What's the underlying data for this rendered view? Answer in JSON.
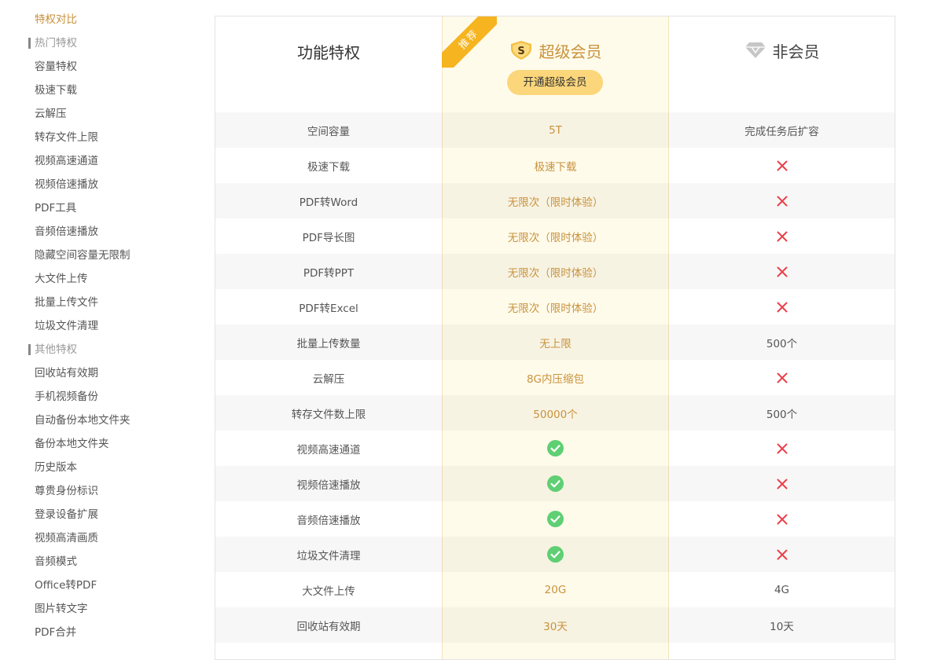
{
  "sidebar": [
    {
      "type": "item",
      "label": "特权对比",
      "active": true
    },
    {
      "type": "group",
      "label": "热门特权"
    },
    {
      "type": "item",
      "label": "容量特权"
    },
    {
      "type": "item",
      "label": "极速下载"
    },
    {
      "type": "item",
      "label": "云解压"
    },
    {
      "type": "item",
      "label": "转存文件上限"
    },
    {
      "type": "item",
      "label": "视频高速通道"
    },
    {
      "type": "item",
      "label": "视频倍速播放"
    },
    {
      "type": "item",
      "label": "PDF工具"
    },
    {
      "type": "item",
      "label": "音频倍速播放"
    },
    {
      "type": "item",
      "label": "隐藏空间容量无限制"
    },
    {
      "type": "item",
      "label": "大文件上传"
    },
    {
      "type": "item",
      "label": "批量上传文件"
    },
    {
      "type": "item",
      "label": "垃圾文件清理"
    },
    {
      "type": "group",
      "label": "其他特权"
    },
    {
      "type": "item",
      "label": "回收站有效期"
    },
    {
      "type": "item",
      "label": "手机视频备份"
    },
    {
      "type": "item",
      "label": "自动备份本地文件夹"
    },
    {
      "type": "item",
      "label": "备份本地文件夹"
    },
    {
      "type": "item",
      "label": "历史版本"
    },
    {
      "type": "item",
      "label": "尊贵身份标识"
    },
    {
      "type": "item",
      "label": "登录设备扩展"
    },
    {
      "type": "item",
      "label": "视频高清画质"
    },
    {
      "type": "item",
      "label": "音频模式"
    },
    {
      "type": "item",
      "label": "Office转PDF"
    },
    {
      "type": "item",
      "label": "图片转文字"
    },
    {
      "type": "item",
      "label": "PDF合并"
    }
  ],
  "header": {
    "feature_label": "功能特权",
    "super_title": "超级会员",
    "super_icon": "s-badge-icon",
    "normal_title": "非会员",
    "normal_icon": "diamond-icon",
    "recommend_ribbon": "推荐",
    "upgrade_button": "开通超级会员"
  },
  "colors": {
    "gold": "#c8923d",
    "button_bg": "#fbd67a",
    "ribbon": "#f5b420",
    "super_bg": "#fffbeb",
    "check": "#5fcf73",
    "cross": "#e9414b"
  },
  "rows": [
    {
      "feature": "空间容量",
      "super": {
        "text": "5T"
      },
      "normal": {
        "text": "完成任务后扩容"
      }
    },
    {
      "feature": "极速下载",
      "super": {
        "text": "极速下载"
      },
      "normal": {
        "icon": "cross-icon"
      }
    },
    {
      "feature": "PDF转Word",
      "super": {
        "text": "无限次（限时体验）"
      },
      "normal": {
        "icon": "cross-icon"
      }
    },
    {
      "feature": "PDF导长图",
      "super": {
        "text": "无限次（限时体验）"
      },
      "normal": {
        "icon": "cross-icon"
      }
    },
    {
      "feature": "PDF转PPT",
      "super": {
        "text": "无限次（限时体验）"
      },
      "normal": {
        "icon": "cross-icon"
      }
    },
    {
      "feature": "PDF转Excel",
      "super": {
        "text": "无限次（限时体验）"
      },
      "normal": {
        "icon": "cross-icon"
      }
    },
    {
      "feature": "批量上传数量",
      "super": {
        "text": "无上限"
      },
      "normal": {
        "text": "500个"
      }
    },
    {
      "feature": "云解压",
      "super": {
        "text": "8G内压缩包"
      },
      "normal": {
        "icon": "cross-icon"
      }
    },
    {
      "feature": "转存文件数上限",
      "super": {
        "text": "50000个"
      },
      "normal": {
        "text": "500个"
      }
    },
    {
      "feature": "视频高速通道",
      "super": {
        "icon": "check-icon"
      },
      "normal": {
        "icon": "cross-icon"
      }
    },
    {
      "feature": "视频倍速播放",
      "super": {
        "icon": "check-icon"
      },
      "normal": {
        "icon": "cross-icon"
      }
    },
    {
      "feature": "音频倍速播放",
      "super": {
        "icon": "check-icon"
      },
      "normal": {
        "icon": "cross-icon"
      }
    },
    {
      "feature": "垃圾文件清理",
      "super": {
        "icon": "check-icon"
      },
      "normal": {
        "icon": "cross-icon"
      }
    },
    {
      "feature": "大文件上传",
      "super": {
        "text": "20G"
      },
      "normal": {
        "text": "4G"
      }
    },
    {
      "feature": "回收站有效期",
      "super": {
        "text": "30天"
      },
      "normal": {
        "text": "10天"
      }
    },
    {
      "feature": "",
      "super": {
        "text": ""
      },
      "normal": {
        "text": ""
      }
    }
  ]
}
